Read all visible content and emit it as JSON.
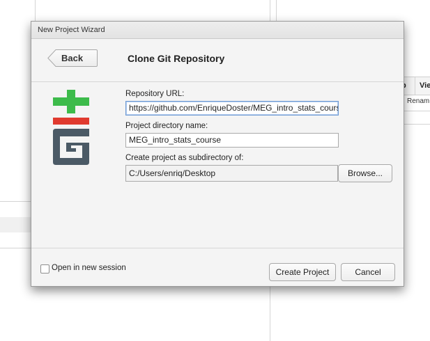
{
  "dialog": {
    "title": "New Project Wizard",
    "back_label": "Back",
    "page_title": "Clone Git Repository",
    "repo_url": {
      "label": "Repository URL:",
      "value": "https://github.com/EnriqueDoster/MEG_intro_stats_course"
    },
    "project_dir": {
      "label": "Project directory name:",
      "value": "MEG_intro_stats_course"
    },
    "subdir": {
      "label": "Create project as subdirectory of:",
      "value": "C:/Users/enriq/Desktop",
      "browse_label": "Browse..."
    },
    "open_new_session_label": "Open in new session",
    "open_new_session_checked": false,
    "create_label": "Create Project",
    "cancel_label": "Cancel"
  },
  "background": {
    "table_header_a": "p",
    "table_header_b": "Vie",
    "table_cell": "Renam"
  },
  "colors": {
    "git_green": "#3dbb4b",
    "git_red": "#e03a2f",
    "git_dark": "#4b5a66",
    "focus_border": "#6e9ad4"
  }
}
